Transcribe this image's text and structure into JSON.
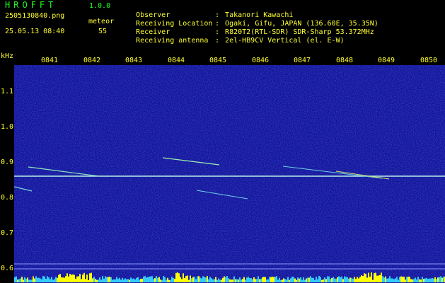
{
  "header": {
    "logo": "HROFFT",
    "version": "1.0.0",
    "file_name": "2505130840.png",
    "meteor_label": "meteor",
    "timestamp": "25.05.13 08:40",
    "meteor_count": "55"
  },
  "info": [
    {
      "key": "Observer",
      "sep": ":",
      "value": "Takanori Kawachi"
    },
    {
      "key": "Receiving Location",
      "sep": ":",
      "value": "Ogaki, Gifu, JAPAN (136.60E, 35.35N)"
    },
    {
      "key": "Receiver",
      "sep": ":",
      "value": "R820T2(RTL-SDR) SDR-Sharp 53.372MHz"
    },
    {
      "key": "Receiving antenna",
      "sep": ":",
      "value": "2el-HB9CV Vertical (el. E-W)"
    }
  ],
  "axes": {
    "y_unit": "kHz",
    "x_ticks": [
      "0841",
      "0842",
      "0843",
      "0844",
      "0845",
      "0846",
      "0847",
      "0848",
      "0849",
      "0850"
    ],
    "y_ticks": [
      "1.1",
      "1.0",
      "0.9",
      "0.8",
      "0.7",
      "0.6"
    ]
  },
  "colors": {
    "background": "#000000",
    "spectrogram_noise": "#1a1a9a",
    "carrier_line": "#b8f0e8",
    "label_yellow": "#ffff33",
    "logo_green": "#22ff22",
    "level_bar_yellow": "#ffff00",
    "level_bar_cyan": "#33ccff"
  }
}
